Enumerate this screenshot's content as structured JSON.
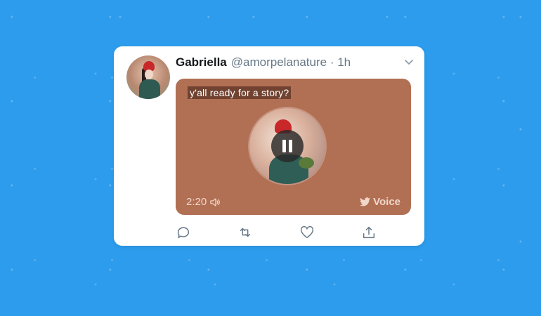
{
  "tweet": {
    "author_name": "Gabriella",
    "handle_time": "@amorpelanature · 1h",
    "caption": "y'all ready for a story?",
    "duration": "2:20",
    "voice_label": "Voice"
  },
  "colors": {
    "background": "#2d9cec",
    "media_background": "#b16f53",
    "card": "#ffffff"
  },
  "icons": [
    "chevron-down-icon",
    "pause-icon",
    "speaker-icon",
    "twitter-bird-icon",
    "reply-icon",
    "retweet-icon",
    "like-icon",
    "share-icon"
  ]
}
